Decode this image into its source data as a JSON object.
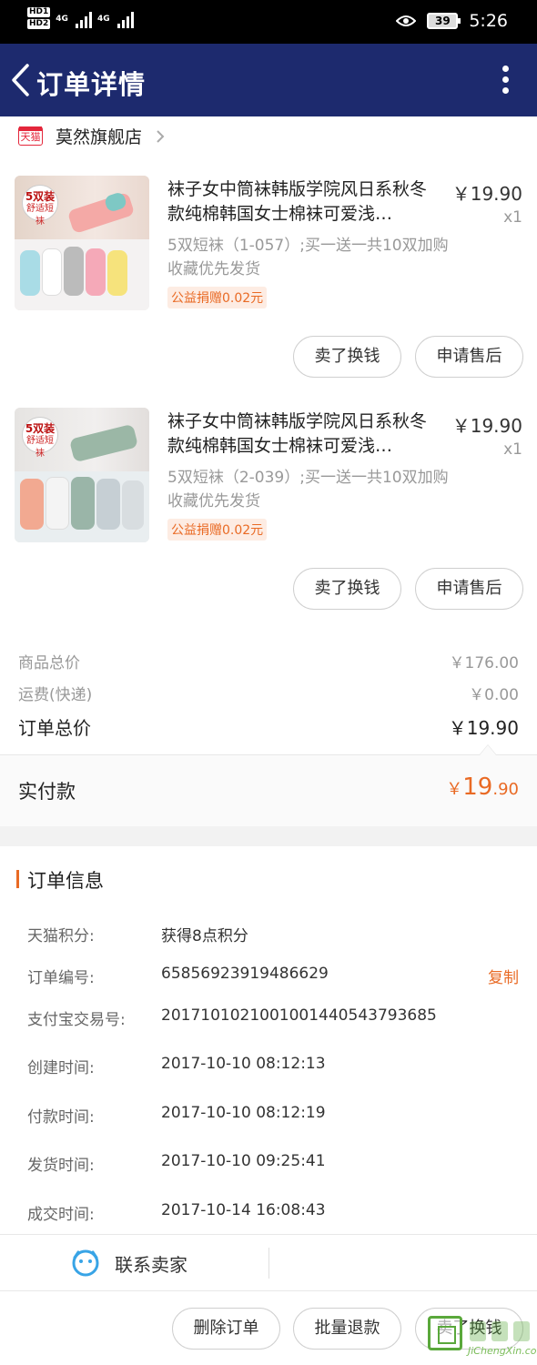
{
  "status_bar": {
    "hd1": "HD",
    "hd1_sub": "1",
    "hd2": "HD",
    "hd2_sub": "2",
    "net1": "4G",
    "net2": "4G",
    "battery": "39",
    "time": "5:26"
  },
  "nav": {
    "title": "订单详情"
  },
  "shop": {
    "badge": "天猫",
    "name": "莫然旗舰店"
  },
  "items": [
    {
      "title": "袜子女中筒袜韩版学院风日系秋冬款纯棉韩国女士棉袜可爱浅…",
      "price": "￥19.90",
      "qty": "x1",
      "sku": "5双短袜（1-057）;买一送一共10双加购收藏优先发货",
      "tag": "公益捐赠0.02元",
      "thumb_badge_top": "5双装",
      "thumb_badge_bottom": "舒适短袜",
      "btn_sell": "卖了换钱",
      "btn_aftersale": "申请售后"
    },
    {
      "title": "袜子女中筒袜韩版学院风日系秋冬款纯棉韩国女士棉袜可爱浅…",
      "price": "￥19.90",
      "qty": "x1",
      "sku": "5双短袜（2-039）;买一送一共10双加购收藏优先发货",
      "tag": "公益捐赠0.02元",
      "thumb_badge_top": "5双装",
      "thumb_badge_bottom": "舒适短袜",
      "btn_sell": "卖了换钱",
      "btn_aftersale": "申请售后"
    }
  ],
  "summary": {
    "goods_label": "商品总价",
    "goods_value": "￥176.00",
    "shipping_label": "运费(快递)",
    "shipping_value": "￥0.00",
    "order_label": "订单总价",
    "order_value": "￥19.90",
    "paid_label": "实付款",
    "paid_currency": "￥",
    "paid_int": "19",
    "paid_dec": ".90"
  },
  "order_info": {
    "title": "订单信息",
    "rows": [
      {
        "key": "天猫积分:",
        "value": "获得8点积分"
      },
      {
        "key": "订单编号:",
        "value": "65856923919486629"
      },
      {
        "key": "支付宝交易号:",
        "value": "2017101021001001440543793685"
      },
      {
        "key": "创建时间:",
        "value": "2017-10-10 08:12:13"
      },
      {
        "key": "付款时间:",
        "value": "2017-10-10 08:12:19"
      },
      {
        "key": "发货时间:",
        "value": "2017-10-10 09:25:41"
      },
      {
        "key": "成交时间:",
        "value": "2017-10-14 16:08:43"
      }
    ],
    "copy_label": "复制"
  },
  "contact": {
    "label": "联系卖家"
  },
  "actions": {
    "delete": "删除订单",
    "refund": "批量退款",
    "sell": "卖了换钱"
  },
  "watermark": {
    "text": "JiChengXin.com"
  },
  "colors": {
    "nav_bg": "#1d2a6e",
    "accent": "#e96a24",
    "tmall": "#e4263b"
  }
}
